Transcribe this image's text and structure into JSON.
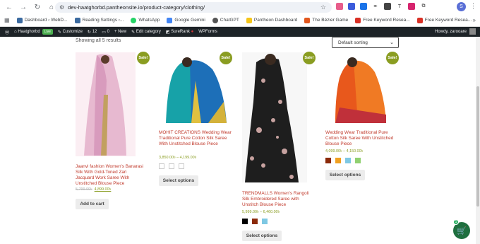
{
  "browser": {
    "url": "dev-haatghorbd.pantheonsite.io/product-category/clothing/",
    "bookmarks": [
      "Dashboard ‹ WebD...",
      "Reading Settings ‹...",
      "WhatsApp",
      "Google Gemini",
      "ChatGPT",
      "Pantheon Dashboard",
      "The Bézier Game",
      "Free Keyword Resea...",
      "Free Keyword Resea..."
    ],
    "profile_initial": "S",
    "more": "»"
  },
  "adminbar": {
    "site": "Haatghorbd",
    "live": "Live",
    "customize": "Customize",
    "updates": "12",
    "comments": "0",
    "new": "New",
    "edit_category": "Edit category",
    "surerank": "SureRank",
    "wpforms": "WPForms",
    "howdy": "Howdy, zarooare"
  },
  "shop": {
    "result_count": "Showing all 5 results",
    "sorting": "Default sorting"
  },
  "products": [
    {
      "title": "Jaanvi fashion Women's Banarasi Silk With Gold-Toned Zari Jacquard Work Saree With Unstitched Blouse Piece",
      "sale": "Sale!",
      "price_old": "5,799.00৳",
      "price_new": "4,899.00৳",
      "button": "Add to cart",
      "colors": []
    },
    {
      "title": "MOHIT CREATIONS Wedding Wear Traditional Pure Cotton Silk Saree With Unstitched Blouse Piece",
      "sale": "Sale!",
      "price_range": "3,850.00৳ – 4,199.00৳",
      "button": "Select options",
      "colors": [
        "#ffffff",
        "#ffffff",
        "#7ec8e3"
      ]
    },
    {
      "title": "TRENDMALLS Women's Rangoli Silk Embroidered Saree with Unstitch Blouse Piece",
      "sale": "Sale!",
      "price_range": "5,999.00৳ – 6,460.00৳",
      "button": "Select options",
      "colors": [
        "#000000",
        "#8b2a0a",
        "#7ec8e3"
      ]
    },
    {
      "title": "Wedding Wear Traditional Pure Cotton Silk Saree With Unstitched Blouse Piece",
      "sale": "Sale!",
      "price_range": "4,099.00৳ – 4,150.00৳",
      "button": "Select options",
      "colors": [
        "#8b2a0a",
        "#f0a020",
        "#7ec8e3",
        "#90d070"
      ]
    }
  ],
  "cart": {
    "count": "1"
  }
}
